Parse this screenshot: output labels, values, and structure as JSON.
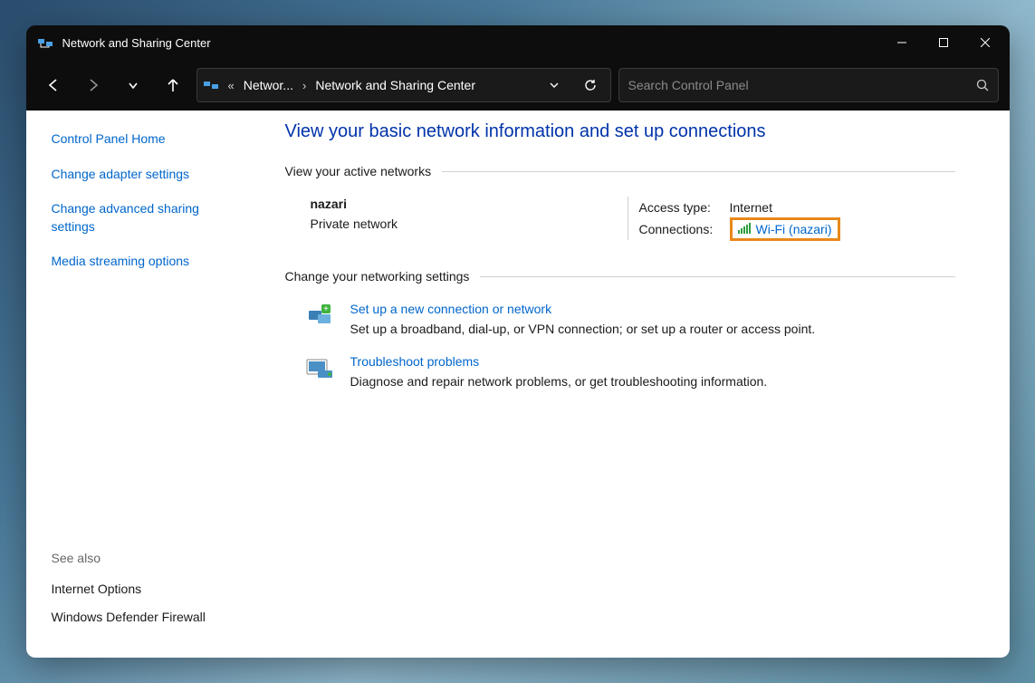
{
  "titlebar": {
    "title": "Network and Sharing Center"
  },
  "nav": {
    "breadcrumb": {
      "part1": "Networ...",
      "part2": "Network and Sharing Center"
    },
    "search_placeholder": "Search Control Panel"
  },
  "sidebar": {
    "links": {
      "home": "Control Panel Home",
      "adapter": "Change adapter settings",
      "advanced": "Change advanced sharing settings",
      "media": "Media streaming options"
    },
    "seealso_label": "See also",
    "seealso": {
      "inet": "Internet Options",
      "firewall": "Windows Defender Firewall"
    }
  },
  "main": {
    "heading": "View your basic network information and set up connections",
    "active_networks_label": "View your active networks",
    "network": {
      "name": "nazari",
      "type": "Private network",
      "access_label": "Access type:",
      "access_value": "Internet",
      "connections_label": "Connections:",
      "wifi_label": "Wi-Fi (nazari)"
    },
    "change_settings_label": "Change your networking settings",
    "tasks": {
      "setup": {
        "title": "Set up a new connection or network",
        "desc": "Set up a broadband, dial-up, or VPN connection; or set up a router or access point."
      },
      "troubleshoot": {
        "title": "Troubleshoot problems",
        "desc": "Diagnose and repair network problems, or get troubleshooting information."
      }
    }
  }
}
